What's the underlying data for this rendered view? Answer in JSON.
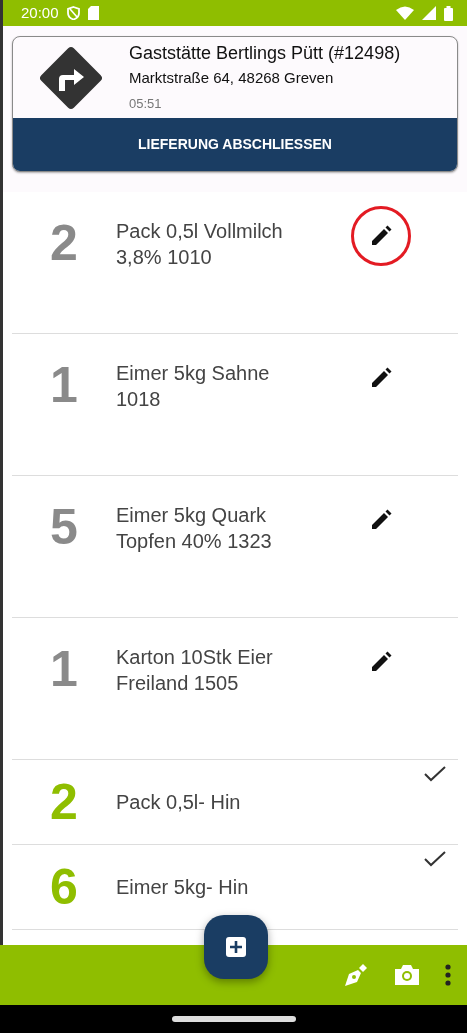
{
  "status_bar": {
    "time": "20:00"
  },
  "delivery": {
    "title": "Gaststätte Bertlings Pütt (#12498)",
    "address": "Marktstraße 64, 48268 Greven",
    "time": "05:51",
    "button": "LIEFERUNG ABSCHLIESSEN"
  },
  "items": [
    {
      "kind": "pending",
      "quantity": "2",
      "name": "Pack 0,5l Vollmilch 3,8% 1010",
      "highlighted": true
    },
    {
      "kind": "pending",
      "quantity": "1",
      "name": "Eimer 5kg Sahne 1018",
      "highlighted": false
    },
    {
      "kind": "pending",
      "quantity": "5",
      "name": "Eimer 5kg Quark Topfen 40% 1323",
      "highlighted": false
    },
    {
      "kind": "pending",
      "quantity": "1",
      "name": "Karton 10Stk Eier Freiland 1505",
      "highlighted": false
    },
    {
      "kind": "done",
      "quantity": "2",
      "name": "Pack 0,5l- Hin"
    },
    {
      "kind": "done",
      "quantity": "6",
      "name": "Eimer 5kg- Hin"
    }
  ]
}
